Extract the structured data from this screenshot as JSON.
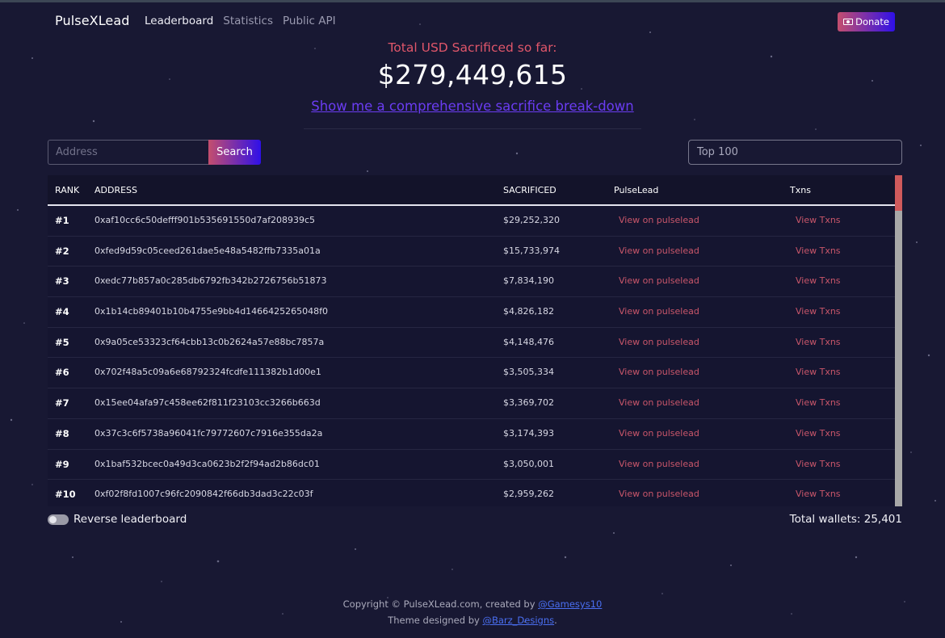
{
  "nav": {
    "brand": "PulseXLead",
    "links": [
      "Leaderboard",
      "Statistics",
      "Public API"
    ],
    "donate_label": "Donate"
  },
  "hero": {
    "label": "Total USD Sacrificed so far:",
    "amount": "$279,449,615",
    "breakdown_link": "Show me a comprehensive sacrifice break-down"
  },
  "search": {
    "placeholder": "Address",
    "button_label": "Search",
    "top_select_value": "Top 100"
  },
  "table": {
    "headers": {
      "rank": "RANK",
      "address": "ADDRESS",
      "sacrificed": "SACRIFICED",
      "pulselead": "PulseLead",
      "txns": "Txns"
    },
    "pulselead_link": "View on pulselead",
    "txns_link": "View Txns",
    "rows": [
      {
        "rank": "#1",
        "address": "0xaf10cc6c50defff901b535691550d7af208939c5",
        "sacrificed": "$29,252,320"
      },
      {
        "rank": "#2",
        "address": "0xfed9d59c05ceed261dae5e48a5482ffb7335a01a",
        "sacrificed": "$15,733,974"
      },
      {
        "rank": "#3",
        "address": "0xedc77b857a0c285db6792fb342b2726756b51873",
        "sacrificed": "$7,834,190"
      },
      {
        "rank": "#4",
        "address": "0x1b14cb89401b10b4755e9bb4d1466425265048f0",
        "sacrificed": "$4,826,182"
      },
      {
        "rank": "#5",
        "address": "0x9a05ce53323cf64cbb13c0b2624a57e88bc7857a",
        "sacrificed": "$4,148,476"
      },
      {
        "rank": "#6",
        "address": "0x702f48a5c09a6e68792324fcdfe111382b1d00e1",
        "sacrificed": "$3,505,334"
      },
      {
        "rank": "#7",
        "address": "0x15ee04afa97c458ee62f811f23103cc3266b663d",
        "sacrificed": "$3,369,702"
      },
      {
        "rank": "#8",
        "address": "0x37c3c6f5738a96041fc79772607c7916e355da2a",
        "sacrificed": "$3,174,393"
      },
      {
        "rank": "#9",
        "address": "0x1baf532bcec0a49d3ca0623b2f2f94ad2b86dc01",
        "sacrificed": "$3,050,001"
      },
      {
        "rank": "#10",
        "address": "0xf02f8fd1007c96fc2090842f66db3dad3c22c03f",
        "sacrificed": "$2,959,262"
      }
    ]
  },
  "controls": {
    "reverse_label": "Reverse leaderboard",
    "total_wallets": "Total wallets: 25,401"
  },
  "footer": {
    "copyright_prefix": "Copyright © PulseXLead.com, created by ",
    "creator_handle": "@Gamesys10",
    "theme_prefix": "Theme designed by ",
    "designer_handle": "@Barz_Designs",
    "theme_suffix": "."
  },
  "colors": {
    "background": "#181833",
    "accent_red": "#e0566a",
    "accent_link": "#6a3cf2",
    "gradient_start": "#c44e6e",
    "gradient_end": "#2f10e8"
  }
}
